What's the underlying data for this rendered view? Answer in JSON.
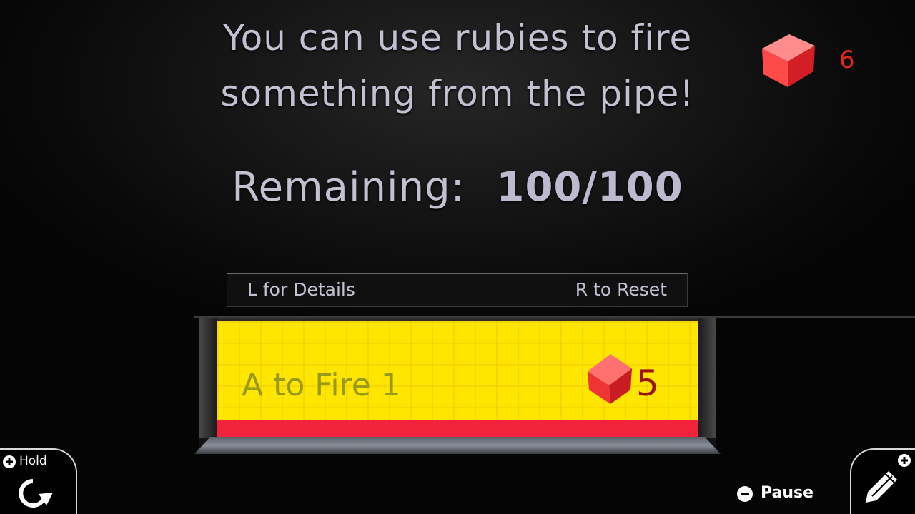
{
  "message": {
    "line1": "You can use rubies to fire",
    "line2": "something from the pipe!"
  },
  "remaining": {
    "label": "Remaining:",
    "value": "100/100"
  },
  "ruby_counter": {
    "icon": "ruby-icon",
    "count": "6"
  },
  "hints": {
    "details": "L for Details",
    "reset": "R to Reset"
  },
  "fire_option": {
    "label": "A to Fire 1",
    "cost": "5",
    "icon": "ruby-icon"
  },
  "corner_controls": {
    "hold_label": "Hold",
    "hold_icon": "rotate-icon",
    "edit_icon": "pencil-icon",
    "pause_label": "Pause"
  },
  "colors": {
    "panel_yellow": "#ffe600",
    "panel_red": "#f2243c",
    "ruby_red": "#e0281e",
    "text_lavender": "#c3c0d2"
  }
}
